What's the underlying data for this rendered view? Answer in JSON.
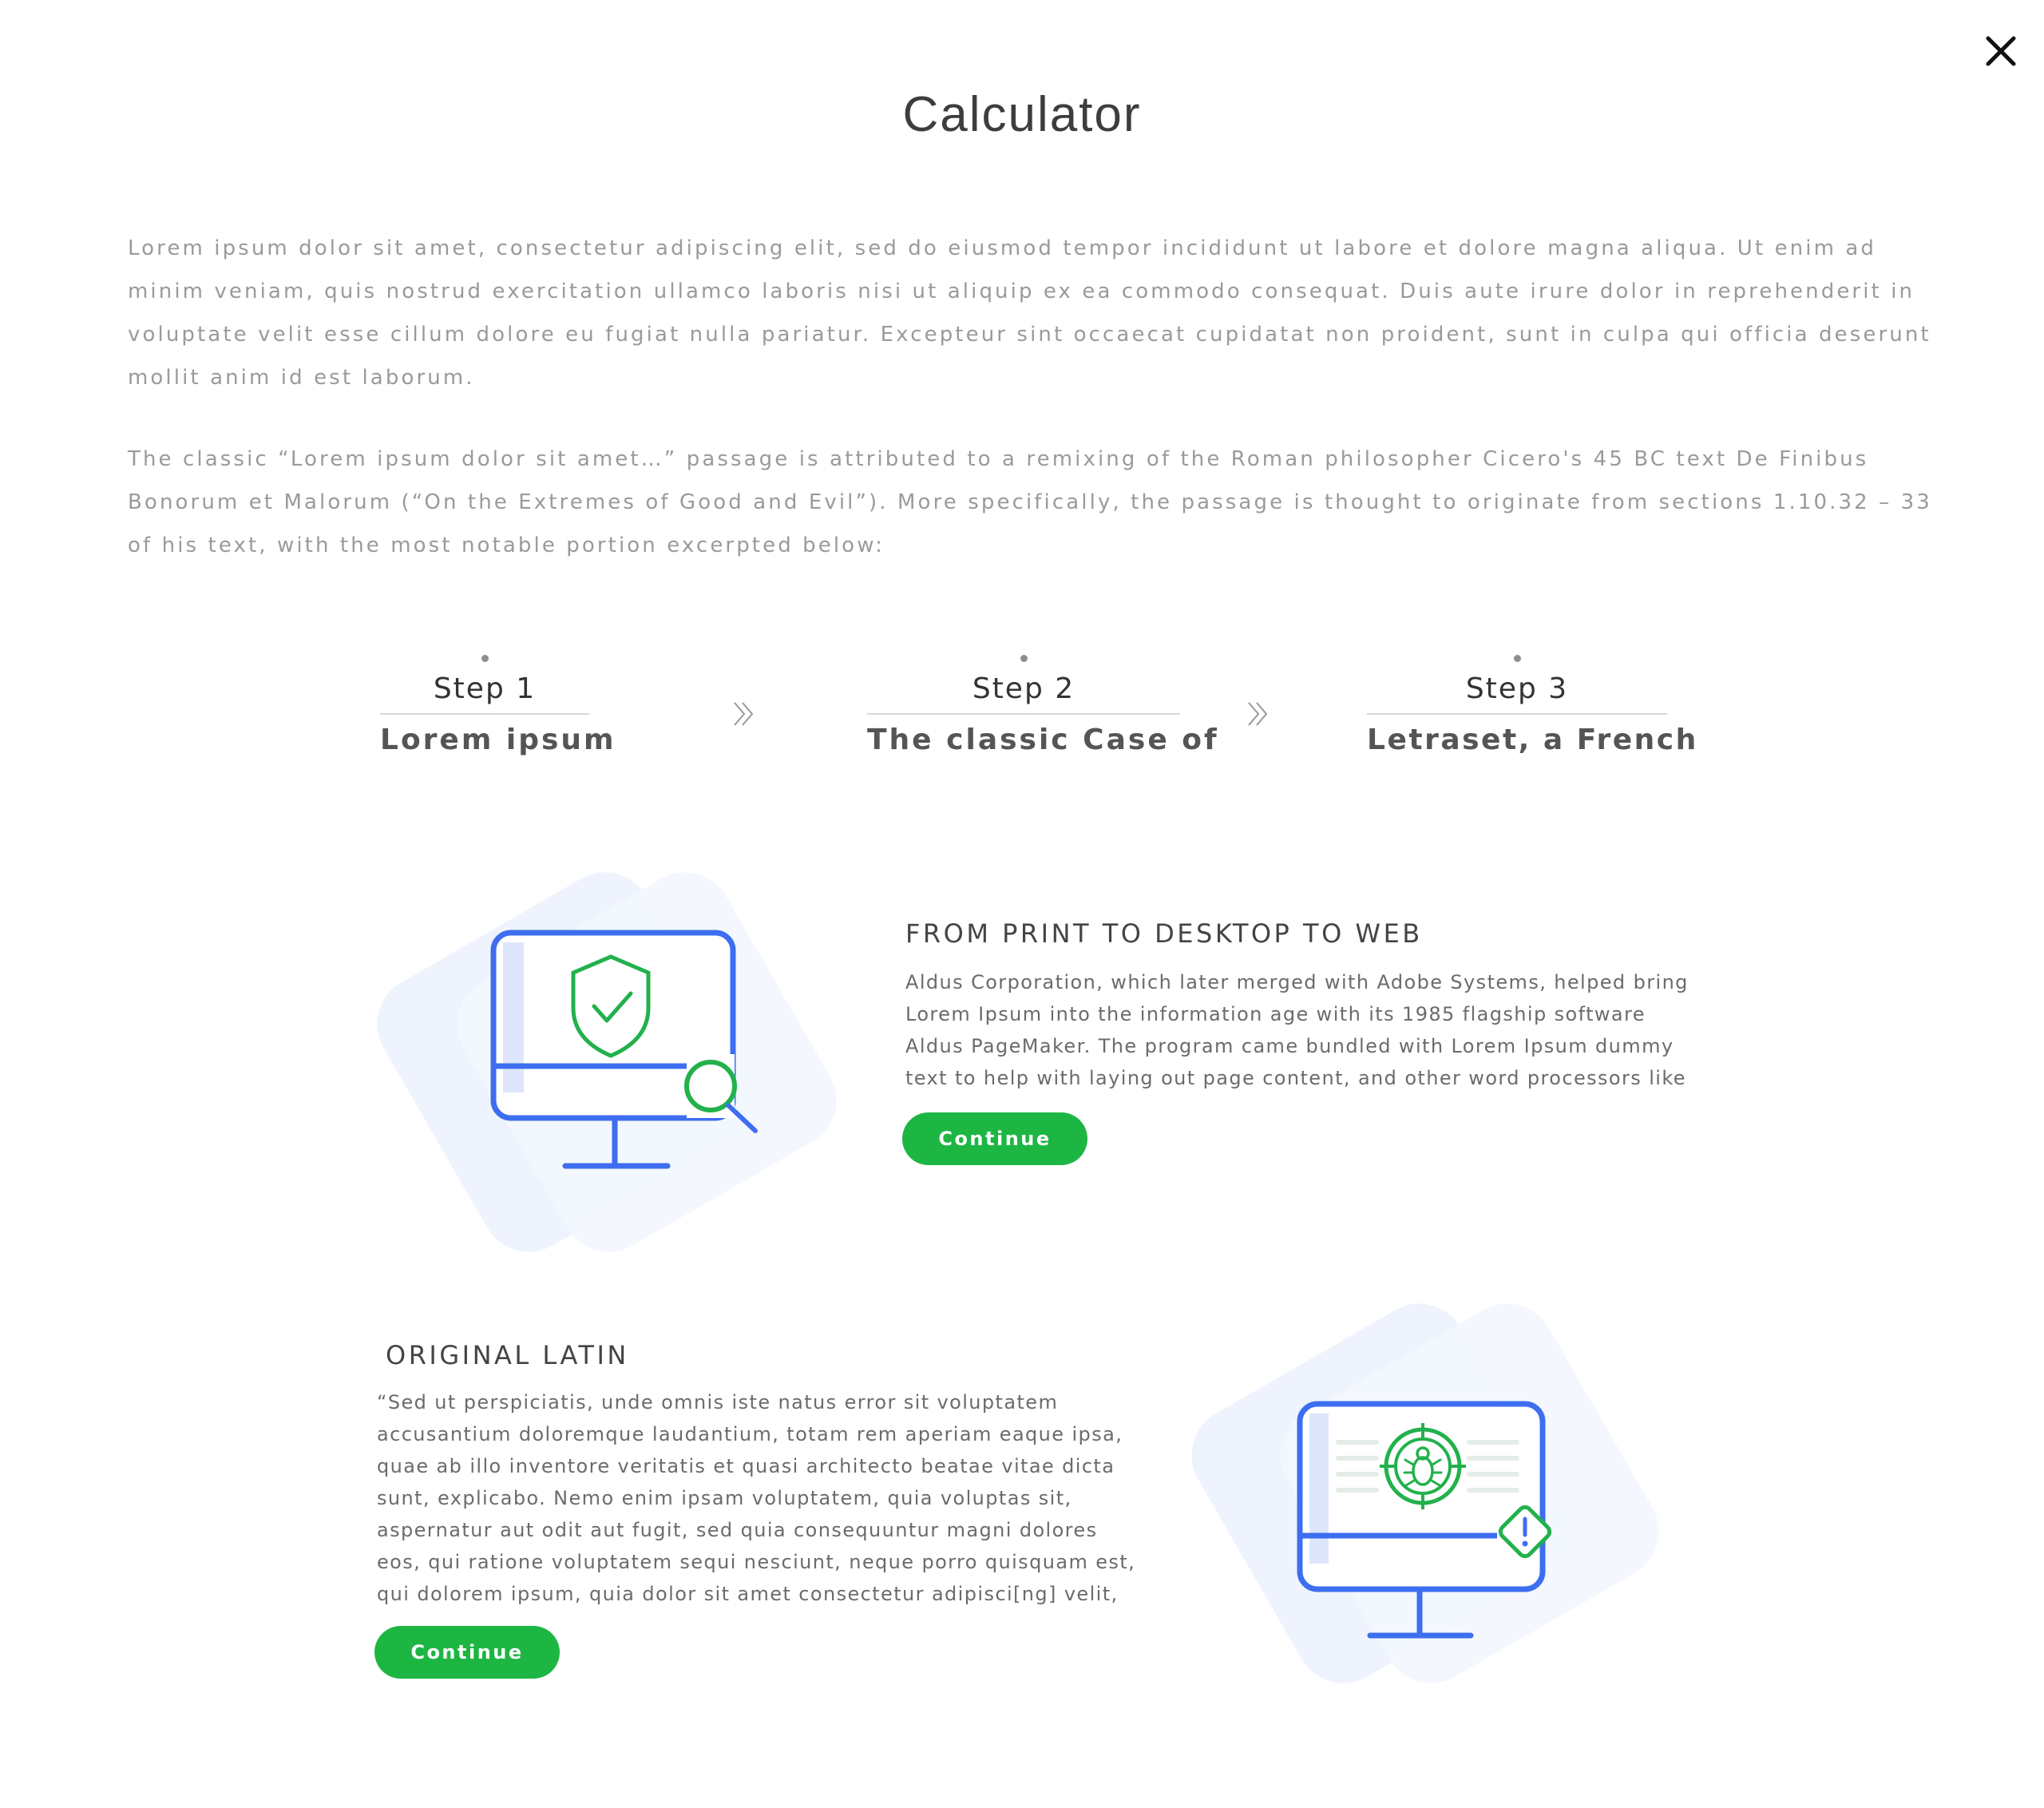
{
  "header": {
    "title": "Calculator",
    "close_label": "×"
  },
  "intro": {
    "paragraph_1": "Lorem ipsum dolor sit amet, consectetur adipiscing elit, sed do eiusmod tempor incididunt ut labore et dolore magna aliqua. Ut enim ad minim veniam, quis nostrud exercitation ullamco laboris nisi ut aliquip ex ea commodo consequat. Duis aute irure dolor in reprehenderit in voluptate velit esse cillum dolore eu fugiat nulla pariatur. Excepteur sint occaecat cupidatat non proident, sunt in culpa qui officia deserunt mollit anim id est laborum.",
    "paragraph_2": "The classic “Lorem ipsum dolor sit amet…” passage is attributed to a remixing of the Roman philosopher Cicero's 45 BC text De Finibus Bonorum et Malorum (“On the Extremes of Good and Evil”). More specifically, the passage is thought to originate from sections 1.10.32 – 33 of his text, with the most notable portion excerpted below:"
  },
  "steps": [
    {
      "number": "Step 1",
      "title": "Lorem ipsum"
    },
    {
      "number": "Step 2",
      "title": "The classic Case of"
    },
    {
      "number": "Step 3",
      "title": "Letraset, a French"
    }
  ],
  "features": [
    {
      "heading": "FROM PRINT TO DESKTOP TO WEB",
      "text": "Aldus Corporation, which later merged with Adobe Systems, helped bring Lorem Ipsum into the information age with its 1985 flagship software Aldus PageMaker. The program came bundled with Lorem Ipsum dummy text to help with laying out page content, and other word processors like",
      "button_label": "Continue",
      "icon": "monitor-shield-search-icon"
    },
    {
      "heading": "ORIGINAL LATIN",
      "text": "“Sed ut perspiciatis, unde omnis iste natus error sit voluptatem accusantium doloremque laudantium, totam rem aperiam eaque ipsa, quae ab illo inventore veritatis et quasi architecto beatae vitae dicta sunt, explicabo. Nemo enim ipsam voluptatem, quia voluptas sit, aspernatur aut odit aut fugit, sed quia consequuntur magni dolores eos, qui ratione voluptatem sequi nesciunt, neque porro quisquam est, qui dolorem ipsum, quia dolor sit amet consectetur adipisci[ng] velit, sed",
      "button_label": "Continue",
      "icon": "monitor-bug-warning-icon"
    }
  ],
  "colors": {
    "accent_green": "#1db643",
    "illustration_blue": "#3d6ef0",
    "illustration_green": "#22b14c",
    "illustration_bg": "#eef3fd",
    "body_text": "#9a9a9a"
  }
}
